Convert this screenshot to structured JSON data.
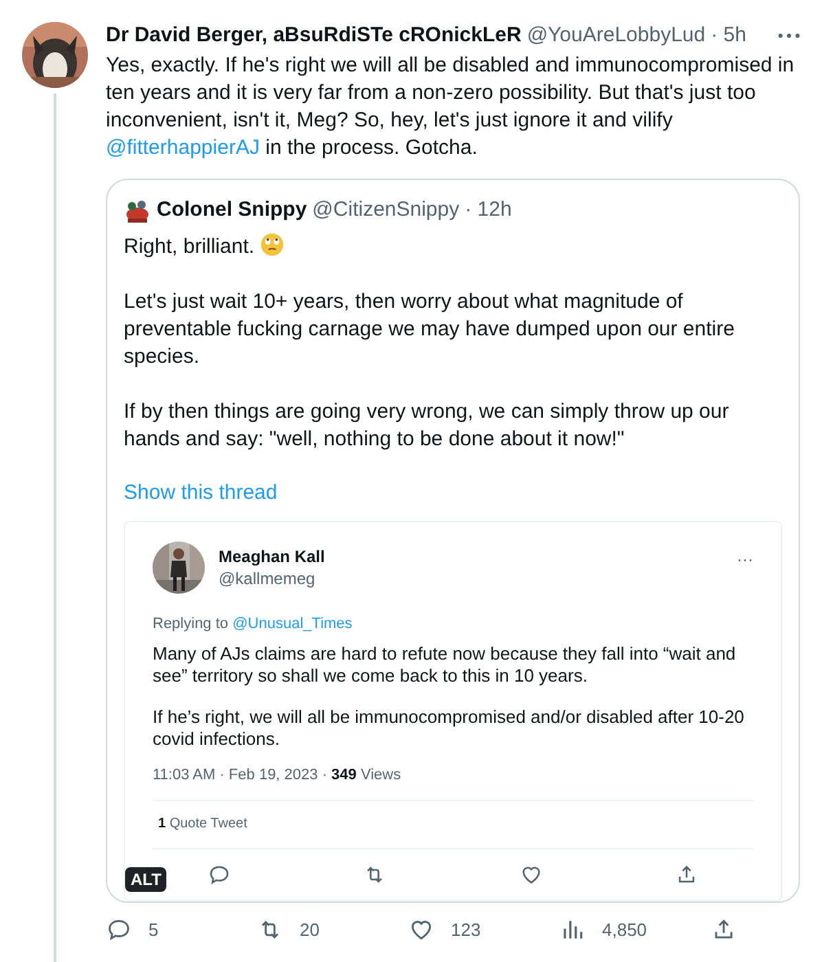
{
  "tweet": {
    "author": "Dr David Berger, aBsuRdiSTe cROnickLeR",
    "handle": "@YouAreLobbyLud",
    "time": "· 5h",
    "text": [
      {
        "kind": "text",
        "text": "Yes, exactly. If he's right we will all be disabled and immunocompromised in ten years and it is very far from a non-zero possibility. But that's just too inconvenient, isn't it, Meg? So, hey, let's just ignore it and vilify "
      },
      {
        "kind": "mention",
        "text": "@fitterhappierAJ"
      },
      {
        "kind": "text",
        "text": " in the process. Gotcha."
      }
    ],
    "quote": {
      "author": "Colonel Snippy",
      "handle": "@CitizenSnippy",
      "time": "· 12h",
      "paragraphs": [
        {
          "text": "Right, brilliant.",
          "emoji": true
        },
        {
          "text": "Let's just wait 10+ years, then worry about what magnitude of preventable fucking carnage we may have dumped upon our entire species.",
          "emoji": false
        },
        {
          "text": "If by then things are going very wrong, we can simply throw up our hands and say: \"well, nothing to be done about it now!\"",
          "emoji": false
        }
      ],
      "show_thread": "Show this thread",
      "screenshot": {
        "author": "Meaghan Kall",
        "handle": "@kallmemeg",
        "more": "···",
        "replying_prefix": "Replying to",
        "replying_to": "@Unusual_Times",
        "paragraphs": [
          "Many of AJs claims are hard to refute now because they fall into “wait and see” territory so shall we come back to this in 10 years.",
          "If he’s right, we will all be immunocompromised and/or disabled after 10-20 covid infections."
        ],
        "meta": "11:03 AM · Feb 19, 2023 · **349** Views",
        "quote_count": "**1** Quote Tweet",
        "actions": [
          {
            "kind": "reply"
          },
          {
            "kind": "retweet"
          },
          {
            "kind": "like"
          },
          {
            "kind": "share"
          }
        ],
        "alt_badge": "ALT"
      }
    },
    "actions": [
      {
        "kind": "reply",
        "count": "5"
      },
      {
        "kind": "retweet",
        "count": "20"
      },
      {
        "kind": "like",
        "count": "123"
      },
      {
        "kind": "views",
        "count": "4,850"
      },
      {
        "kind": "share"
      }
    ]
  }
}
